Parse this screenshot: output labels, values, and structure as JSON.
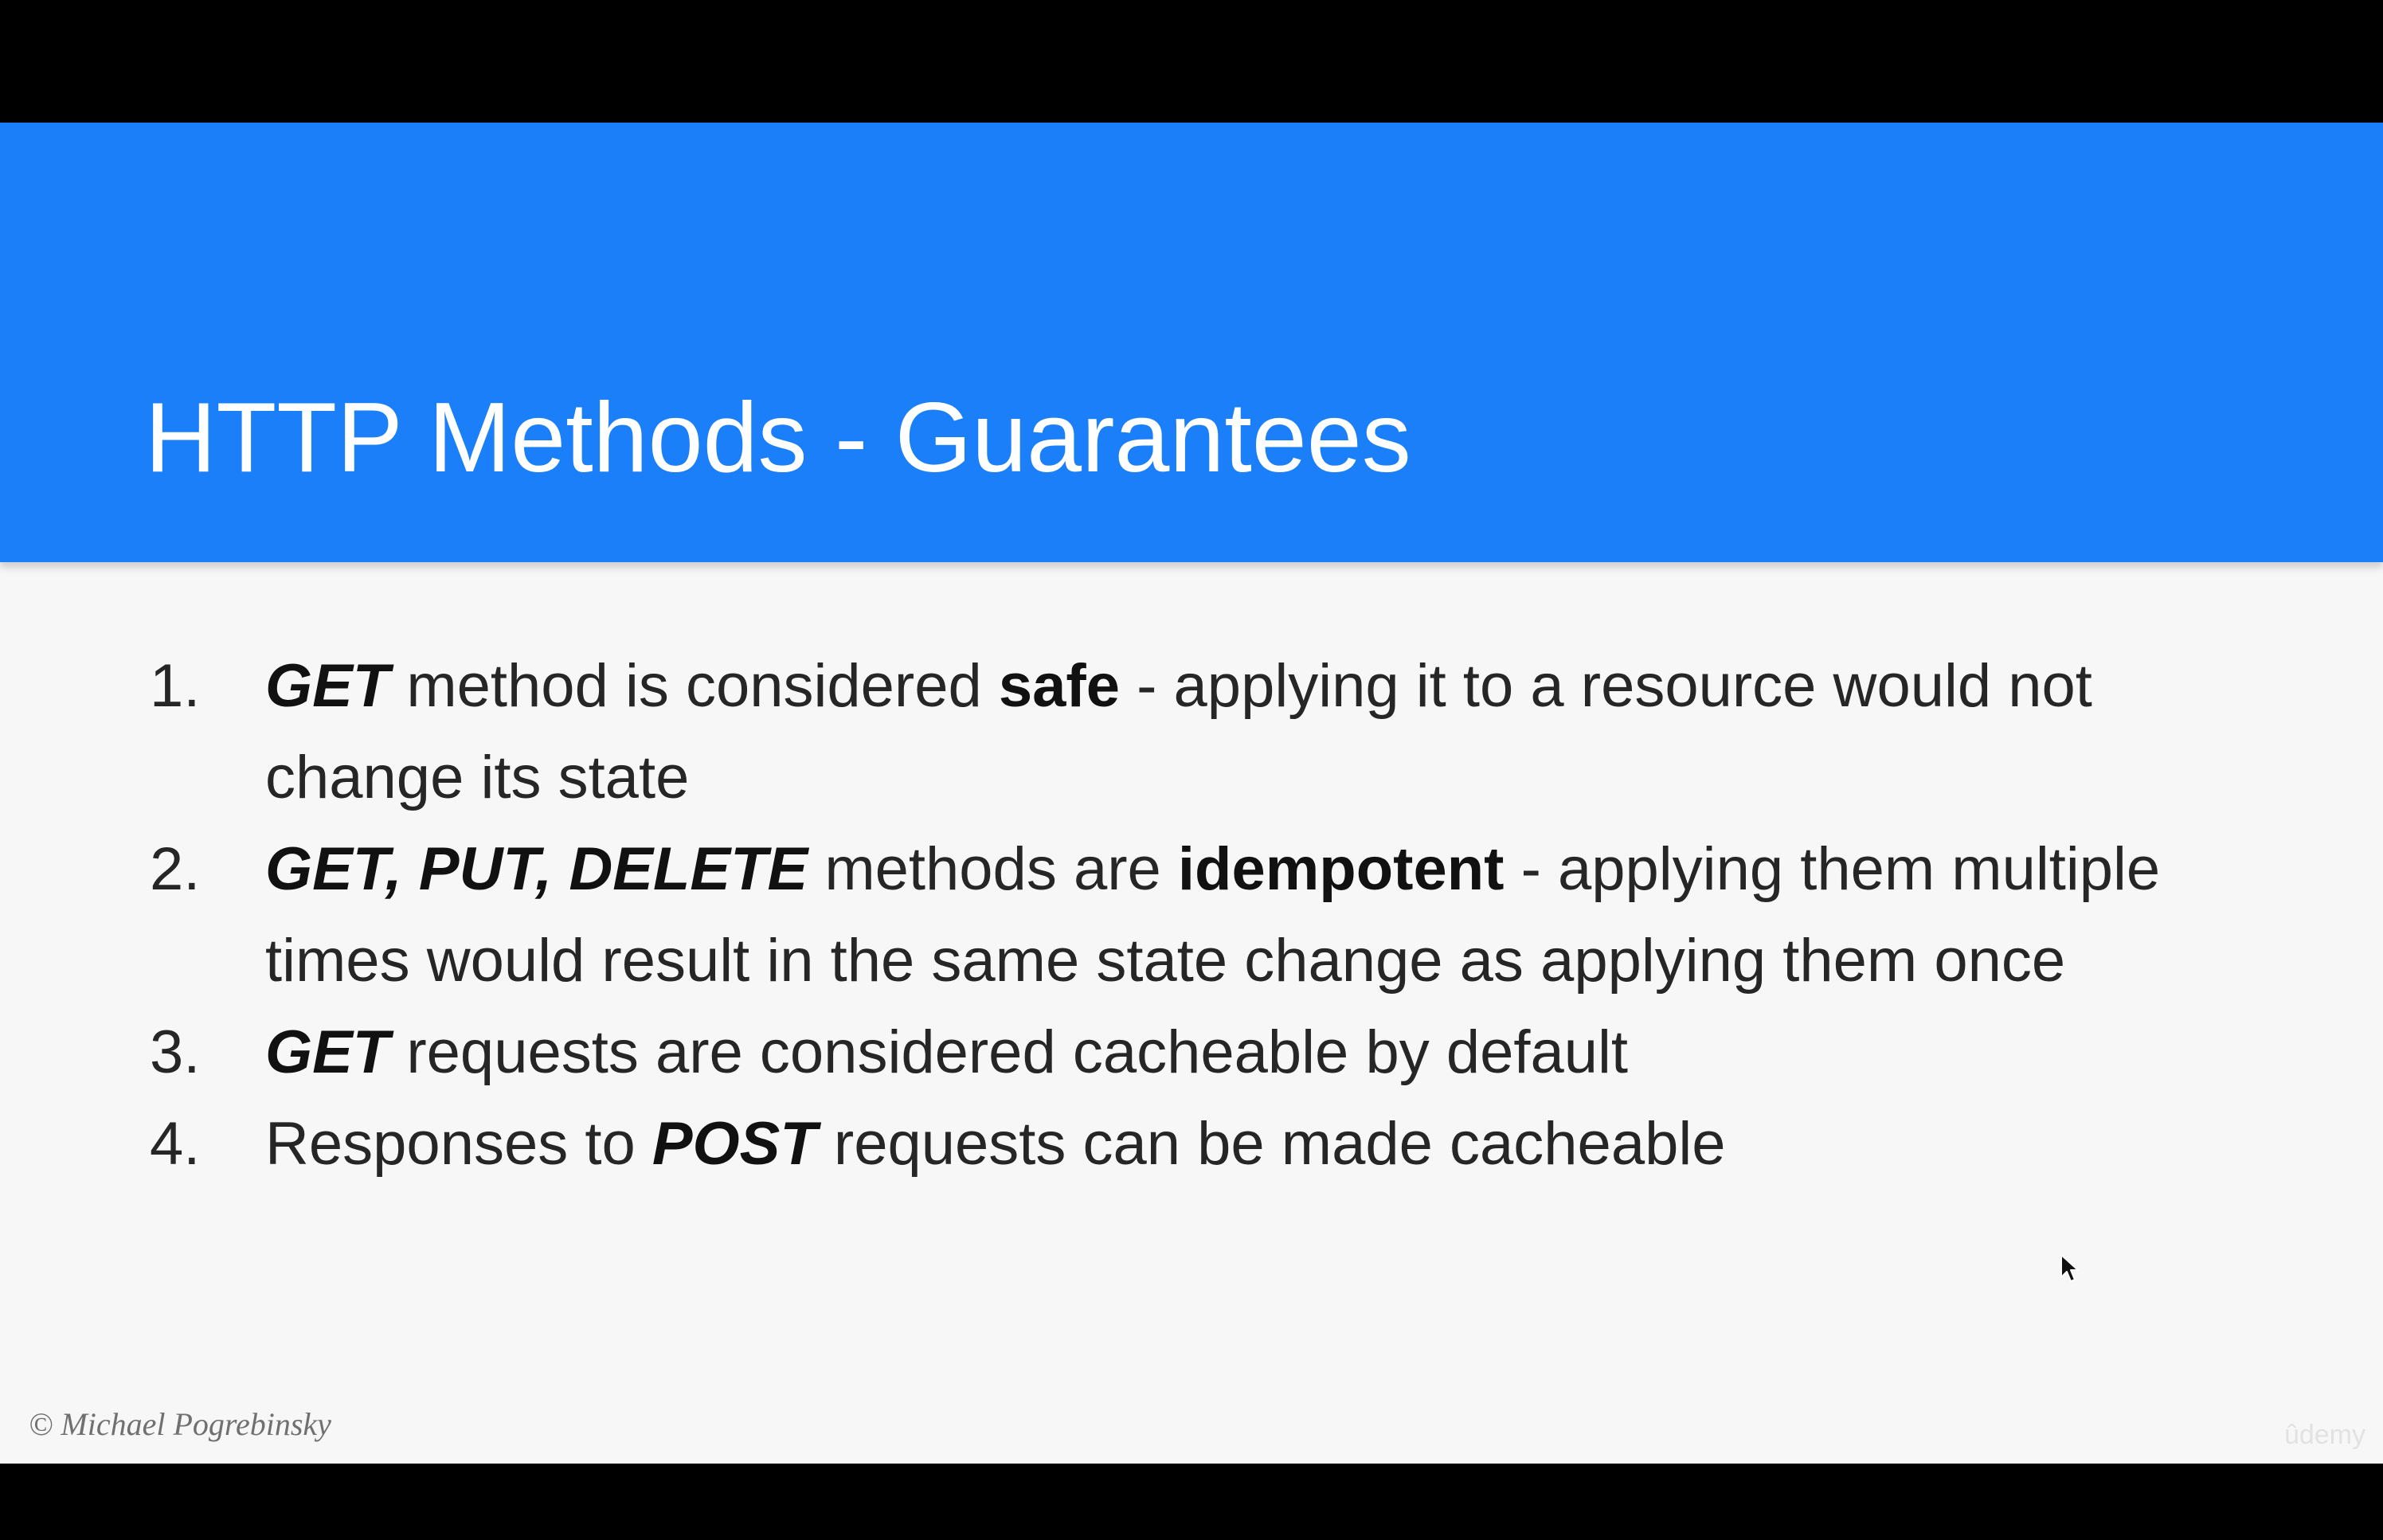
{
  "slide": {
    "title": "HTTP Methods - Guarantees",
    "items": [
      {
        "number": "1.",
        "segments": [
          {
            "text": "GET",
            "style": "bold-italic"
          },
          {
            "text": " method is considered ",
            "style": "normal"
          },
          {
            "text": "safe",
            "style": "bold"
          },
          {
            "text": " - applying it to a resource would not change its state",
            "style": "normal"
          }
        ]
      },
      {
        "number": "2.",
        "segments": [
          {
            "text": "GET, PUT, DELETE",
            "style": "bold-italic"
          },
          {
            "text": " methods are ",
            "style": "normal"
          },
          {
            "text": "idempotent",
            "style": "bold"
          },
          {
            "text": " - applying them multiple times would result in the same state change as applying them once",
            "style": "normal"
          }
        ]
      },
      {
        "number": "3.",
        "segments": [
          {
            "text": "GET",
            "style": "bold-italic"
          },
          {
            "text": " requests are considered cacheable by default",
            "style": "normal"
          }
        ]
      },
      {
        "number": "4.",
        "segments": [
          {
            "text": "Responses to ",
            "style": "normal"
          },
          {
            "text": "POST",
            "style": "bold-italic"
          },
          {
            "text": " requests can be made cacheable",
            "style": "normal"
          }
        ]
      }
    ],
    "copyright": "© Michael Pogrebinsky",
    "watermark": "ûdemy"
  },
  "colors": {
    "header_background": "#1a7ff8",
    "slide_background": "#f7f7f7",
    "letterbox": "#000000",
    "body_text": "#262626"
  },
  "icons": {
    "cursor": "mouse-pointer-icon"
  }
}
